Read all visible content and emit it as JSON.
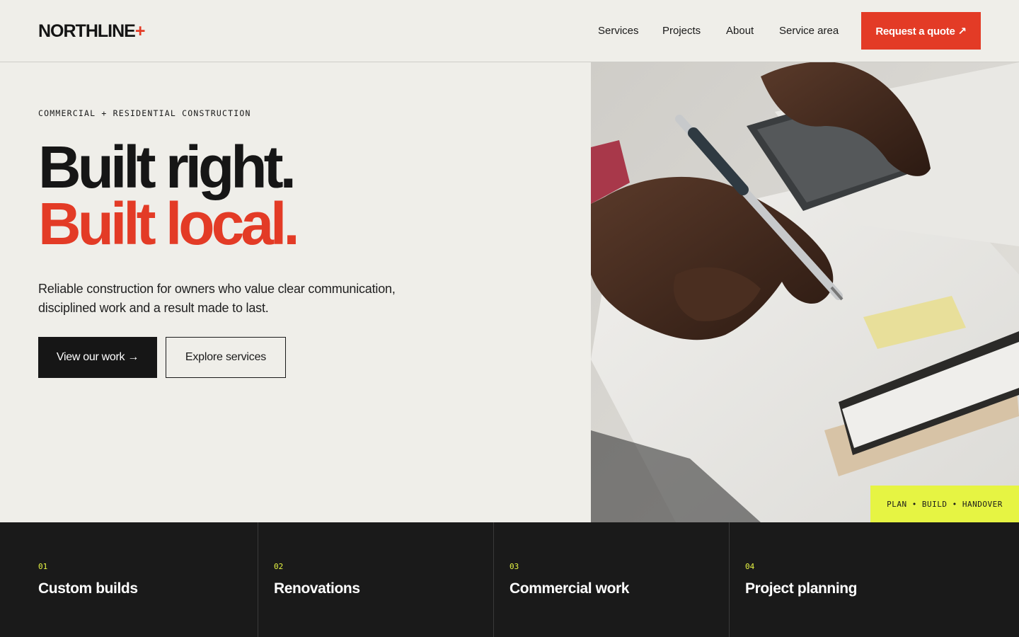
{
  "header": {
    "logo_text": "NORTHLINE",
    "logo_mark": "+",
    "nav": [
      "Services",
      "Projects",
      "About",
      "Service area"
    ],
    "cta_label": "Request a quote ↗"
  },
  "hero": {
    "eyebrow": "COMMERCIAL + RESIDENTIAL CONSTRUCTION",
    "headline_line1": "Built right.",
    "headline_line2": "Built local.",
    "lede": "Reliable construction for owners who value clear communication, disciplined work and a result made to last.",
    "primary_button": "View our work →",
    "secondary_button": "Explore services",
    "image_tag": "PLAN • BUILD • HANDOVER"
  },
  "services": [
    {
      "num": "01",
      "title": "Custom builds"
    },
    {
      "num": "02",
      "title": "Renovations"
    },
    {
      "num": "03",
      "title": "Commercial work"
    },
    {
      "num": "04",
      "title": "Project planning"
    }
  ],
  "colors": {
    "accent": "#e33b26",
    "highlight": "#e6f443",
    "dark": "#1a1a1a",
    "background": "#efeee9"
  }
}
